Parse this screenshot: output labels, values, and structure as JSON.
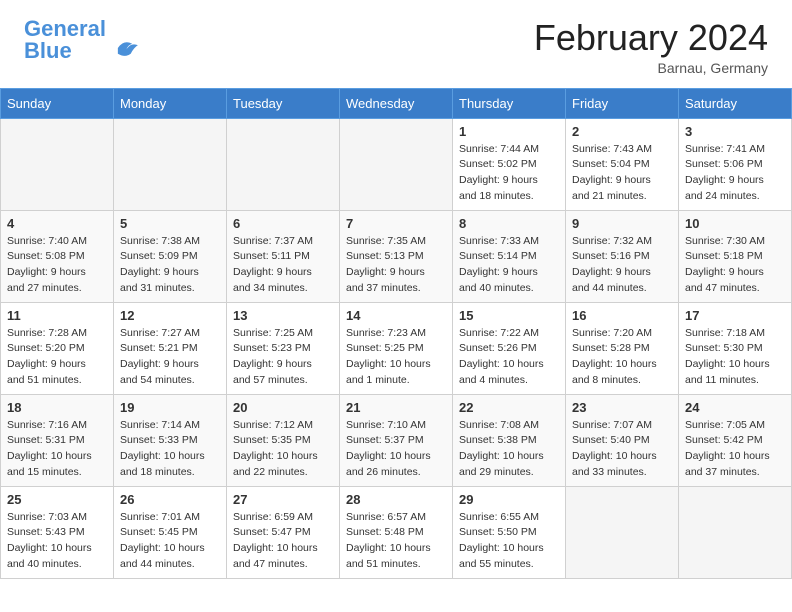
{
  "header": {
    "logo_line1": "General",
    "logo_line2": "Blue",
    "month_title": "February 2024",
    "location": "Barnau, Germany"
  },
  "weekdays": [
    "Sunday",
    "Monday",
    "Tuesday",
    "Wednesday",
    "Thursday",
    "Friday",
    "Saturday"
  ],
  "weeks": [
    [
      {
        "day": "",
        "info": ""
      },
      {
        "day": "",
        "info": ""
      },
      {
        "day": "",
        "info": ""
      },
      {
        "day": "",
        "info": ""
      },
      {
        "day": "1",
        "info": "Sunrise: 7:44 AM\nSunset: 5:02 PM\nDaylight: 9 hours\nand 18 minutes."
      },
      {
        "day": "2",
        "info": "Sunrise: 7:43 AM\nSunset: 5:04 PM\nDaylight: 9 hours\nand 21 minutes."
      },
      {
        "day": "3",
        "info": "Sunrise: 7:41 AM\nSunset: 5:06 PM\nDaylight: 9 hours\nand 24 minutes."
      }
    ],
    [
      {
        "day": "4",
        "info": "Sunrise: 7:40 AM\nSunset: 5:08 PM\nDaylight: 9 hours\nand 27 minutes."
      },
      {
        "day": "5",
        "info": "Sunrise: 7:38 AM\nSunset: 5:09 PM\nDaylight: 9 hours\nand 31 minutes."
      },
      {
        "day": "6",
        "info": "Sunrise: 7:37 AM\nSunset: 5:11 PM\nDaylight: 9 hours\nand 34 minutes."
      },
      {
        "day": "7",
        "info": "Sunrise: 7:35 AM\nSunset: 5:13 PM\nDaylight: 9 hours\nand 37 minutes."
      },
      {
        "day": "8",
        "info": "Sunrise: 7:33 AM\nSunset: 5:14 PM\nDaylight: 9 hours\nand 40 minutes."
      },
      {
        "day": "9",
        "info": "Sunrise: 7:32 AM\nSunset: 5:16 PM\nDaylight: 9 hours\nand 44 minutes."
      },
      {
        "day": "10",
        "info": "Sunrise: 7:30 AM\nSunset: 5:18 PM\nDaylight: 9 hours\nand 47 minutes."
      }
    ],
    [
      {
        "day": "11",
        "info": "Sunrise: 7:28 AM\nSunset: 5:20 PM\nDaylight: 9 hours\nand 51 minutes."
      },
      {
        "day": "12",
        "info": "Sunrise: 7:27 AM\nSunset: 5:21 PM\nDaylight: 9 hours\nand 54 minutes."
      },
      {
        "day": "13",
        "info": "Sunrise: 7:25 AM\nSunset: 5:23 PM\nDaylight: 9 hours\nand 57 minutes."
      },
      {
        "day": "14",
        "info": "Sunrise: 7:23 AM\nSunset: 5:25 PM\nDaylight: 10 hours\nand 1 minute."
      },
      {
        "day": "15",
        "info": "Sunrise: 7:22 AM\nSunset: 5:26 PM\nDaylight: 10 hours\nand 4 minutes."
      },
      {
        "day": "16",
        "info": "Sunrise: 7:20 AM\nSunset: 5:28 PM\nDaylight: 10 hours\nand 8 minutes."
      },
      {
        "day": "17",
        "info": "Sunrise: 7:18 AM\nSunset: 5:30 PM\nDaylight: 10 hours\nand 11 minutes."
      }
    ],
    [
      {
        "day": "18",
        "info": "Sunrise: 7:16 AM\nSunset: 5:31 PM\nDaylight: 10 hours\nand 15 minutes."
      },
      {
        "day": "19",
        "info": "Sunrise: 7:14 AM\nSunset: 5:33 PM\nDaylight: 10 hours\nand 18 minutes."
      },
      {
        "day": "20",
        "info": "Sunrise: 7:12 AM\nSunset: 5:35 PM\nDaylight: 10 hours\nand 22 minutes."
      },
      {
        "day": "21",
        "info": "Sunrise: 7:10 AM\nSunset: 5:37 PM\nDaylight: 10 hours\nand 26 minutes."
      },
      {
        "day": "22",
        "info": "Sunrise: 7:08 AM\nSunset: 5:38 PM\nDaylight: 10 hours\nand 29 minutes."
      },
      {
        "day": "23",
        "info": "Sunrise: 7:07 AM\nSunset: 5:40 PM\nDaylight: 10 hours\nand 33 minutes."
      },
      {
        "day": "24",
        "info": "Sunrise: 7:05 AM\nSunset: 5:42 PM\nDaylight: 10 hours\nand 37 minutes."
      }
    ],
    [
      {
        "day": "25",
        "info": "Sunrise: 7:03 AM\nSunset: 5:43 PM\nDaylight: 10 hours\nand 40 minutes."
      },
      {
        "day": "26",
        "info": "Sunrise: 7:01 AM\nSunset: 5:45 PM\nDaylight: 10 hours\nand 44 minutes."
      },
      {
        "day": "27",
        "info": "Sunrise: 6:59 AM\nSunset: 5:47 PM\nDaylight: 10 hours\nand 47 minutes."
      },
      {
        "day": "28",
        "info": "Sunrise: 6:57 AM\nSunset: 5:48 PM\nDaylight: 10 hours\nand 51 minutes."
      },
      {
        "day": "29",
        "info": "Sunrise: 6:55 AM\nSunset: 5:50 PM\nDaylight: 10 hours\nand 55 minutes."
      },
      {
        "day": "",
        "info": ""
      },
      {
        "day": "",
        "info": ""
      }
    ]
  ]
}
